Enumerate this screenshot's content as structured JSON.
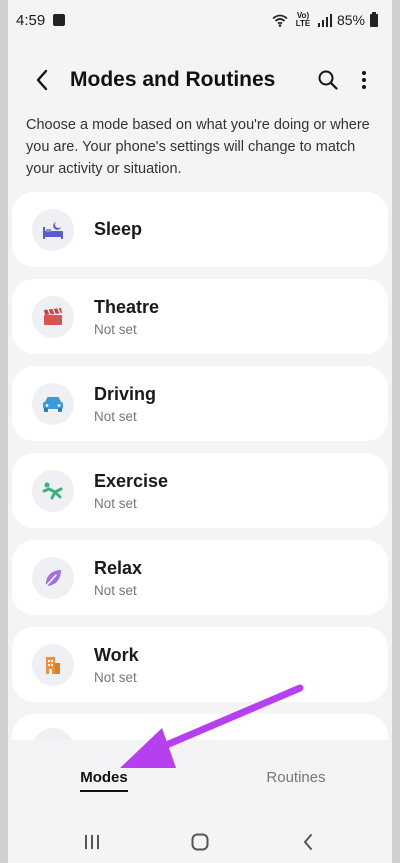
{
  "status_bar": {
    "time": "4:59",
    "network_label": "Vo) LTE",
    "battery": "85%"
  },
  "header": {
    "title": "Modes and Routines"
  },
  "description": "Choose a mode based on what you're doing or where you are. Your phone's settings will change to match your activity or situation.",
  "modes": [
    {
      "name": "Sleep",
      "status": "",
      "icon": "bed-icon",
      "color": "#5b5bd6"
    },
    {
      "name": "Theatre",
      "status": "Not set",
      "icon": "clapperboard-icon",
      "color": "#d9534f"
    },
    {
      "name": "Driving",
      "status": "Not set",
      "icon": "car-icon",
      "color": "#3a9ad9"
    },
    {
      "name": "Exercise",
      "status": "Not set",
      "icon": "running-icon",
      "color": "#3db37a"
    },
    {
      "name": "Relax",
      "status": "Not set",
      "icon": "leaf-icon",
      "color": "#a56de2"
    },
    {
      "name": "Work",
      "status": "Not set",
      "icon": "building-icon",
      "color": "#f0913a"
    }
  ],
  "tabs": {
    "modes": "Modes",
    "routines": "Routines",
    "active": "modes"
  },
  "colors": {
    "arrow": "#b63ff0",
    "background": "#f4f4f6"
  }
}
